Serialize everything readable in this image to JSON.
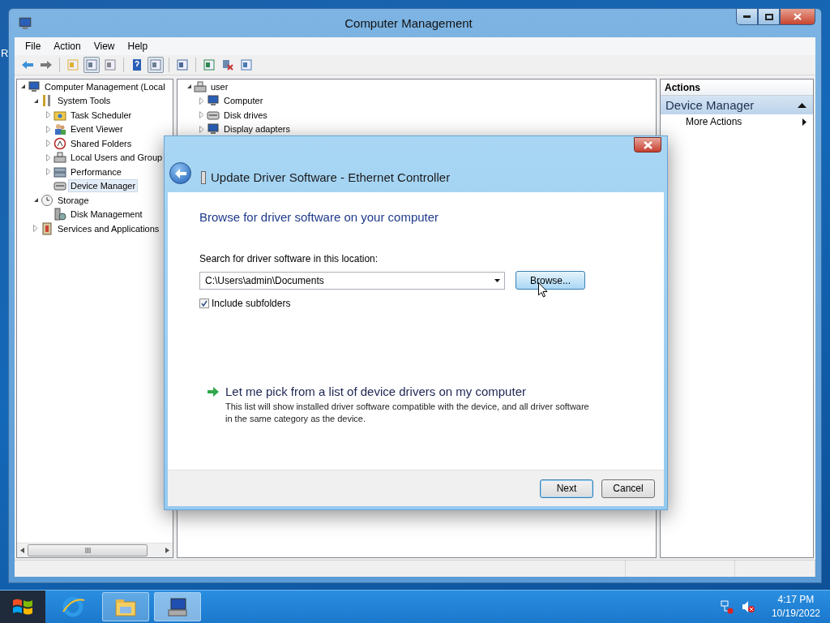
{
  "desktop": {
    "icon_label": "R"
  },
  "window": {
    "title": "Computer Management"
  },
  "menu": [
    "File",
    "Action",
    "View",
    "Help"
  ],
  "toolbar": [
    {
      "pressed": false
    },
    {
      "pressed": false
    },
    {
      "pressed": false
    },
    {
      "pressed": true
    },
    {
      "pressed": false
    },
    {
      "pressed": false
    },
    {
      "pressed": true
    },
    {
      "pressed": false
    },
    {
      "pressed": false
    },
    {
      "pressed": false
    },
    {
      "pressed": false
    }
  ],
  "console_tree": [
    {
      "label": "Computer Management (Local",
      "expanded": true,
      "selected": false,
      "children": [
        {
          "label": "System Tools",
          "expanded": true,
          "selected": false,
          "children": [
            {
              "label": "Task Scheduler",
              "expanded": false,
              "selected": false
            },
            {
              "label": "Event Viewer",
              "expanded": false,
              "selected": false
            },
            {
              "label": "Shared Folders",
              "expanded": false,
              "selected": false
            },
            {
              "label": "Local Users and Group",
              "expanded": false,
              "selected": false
            },
            {
              "label": "Performance",
              "expanded": false,
              "selected": false
            },
            {
              "label": "Device Manager",
              "selected": true
            }
          ]
        },
        {
          "label": "Storage",
          "expanded": true,
          "selected": false,
          "children": [
            {
              "label": "Disk Management",
              "selected": false
            }
          ]
        },
        {
          "label": "Services and Applications",
          "expanded": false,
          "selected": false
        }
      ]
    }
  ],
  "device_tree": [
    {
      "label": "user",
      "expanded": true,
      "children": [
        {
          "label": "Computer",
          "expanded": false
        },
        {
          "label": "Disk drives",
          "expanded": false
        },
        {
          "label": "Display adapters",
          "expanded": false
        }
      ]
    }
  ],
  "actions": {
    "title": "Actions",
    "section": {
      "label": "Device Manager",
      "expanded": true
    },
    "items": [
      {
        "label": "More Actions"
      }
    ]
  },
  "dialog": {
    "title": "Update Driver Software - Ethernet Controller",
    "heading": "Browse for driver software on your computer",
    "location_label": "Search for driver software in this location:",
    "location_value": "C:\\Users\\admin\\Documents",
    "browse_button": "Browse...",
    "include_subfolders": {
      "label": "Include subfolders",
      "checked": true
    },
    "pick_link": {
      "title": "Let me pick from a list of device drivers on my computer",
      "description": "This list will show installed driver software compatible with the device, and all driver software in the same category as the device."
    },
    "buttons": [
      {
        "label": "Next",
        "default": true
      },
      {
        "label": "Cancel",
        "default": false
      }
    ]
  },
  "taskbar": {
    "items": [
      {
        "running": false,
        "active": false
      },
      {
        "running": true,
        "active": false
      },
      {
        "running": true,
        "active": true
      }
    ],
    "clock": {
      "time": "4:17 PM",
      "date": "10/19/2022"
    }
  }
}
